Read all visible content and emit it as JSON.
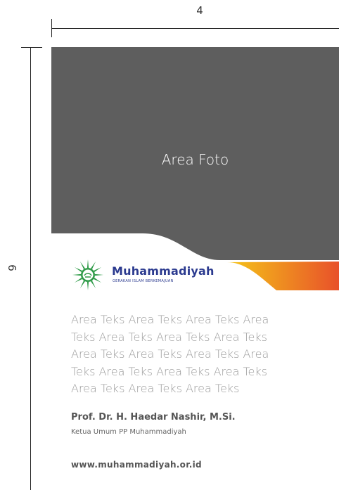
{
  "dimensions": {
    "width_label": "4",
    "height_label": "6"
  },
  "photo": {
    "label": "Area Foto",
    "color": "#5e5e5e"
  },
  "brand": {
    "name": "Muhammadiyah",
    "tagline": "GERAKAN ISLAM BERKEMAJUAN",
    "color": "#2b3a8f",
    "emblem_color": "#2e9a47",
    "accent_gradient": [
      "#f5c518",
      "#e8512a"
    ]
  },
  "content": {
    "body_lines": [
      "Area Teks Area Teks Area Teks Area",
      "Teks Area Teks Area Teks Area Teks",
      "Area Teks Area Teks Area Teks Area",
      "Teks Area Teks Area Teks Area Teks",
      "Area Teks Area Teks Area Teks"
    ],
    "signatory_name": "Prof. Dr. H. Haedar Nashir, M.Si.",
    "signatory_title": "Ketua Umum PP Muhammadiyah",
    "website": "www.muhammadiyah.or.id"
  }
}
